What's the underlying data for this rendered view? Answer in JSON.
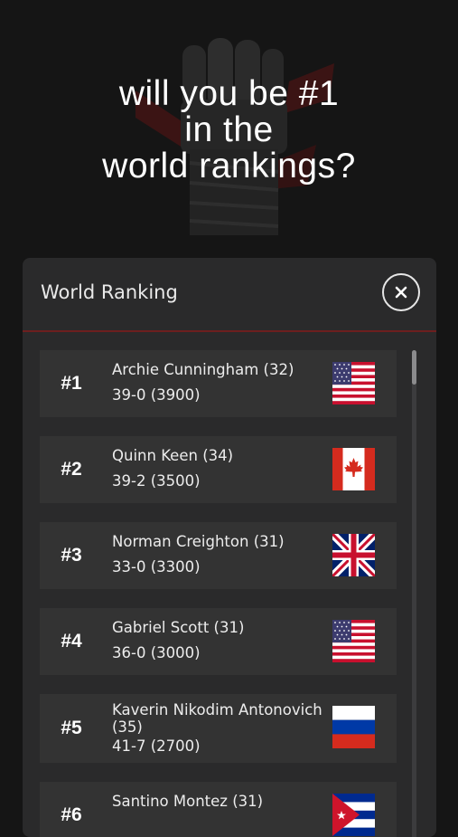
{
  "hero": {
    "line1": "will you be #1",
    "line2": "in the",
    "line3": "world rankings?",
    "art_icon": "raised-fist-icon"
  },
  "panel": {
    "title": "World Ranking",
    "close_icon": "close-icon",
    "accent_color": "#6d1f1f"
  },
  "rankings": [
    {
      "rank": "#1",
      "name": "Archie Cunningham (32)",
      "record": "39-0 (3900)",
      "flag": "usa-flag-icon"
    },
    {
      "rank": "#2",
      "name": "Quinn Keen (34)",
      "record": "39-2 (3500)",
      "flag": "canada-flag-icon"
    },
    {
      "rank": "#3",
      "name": "Norman Creighton (31)",
      "record": "33-0 (3300)",
      "flag": "uk-flag-icon"
    },
    {
      "rank": "#4",
      "name": "Gabriel Scott (31)",
      "record": "36-0 (3000)",
      "flag": "usa-flag-icon"
    },
    {
      "rank": "#5",
      "name": "Kaverin Nikodim Antonovich (35)",
      "record": "41-7 (2700)",
      "flag": "russia-flag-icon"
    },
    {
      "rank": "#6",
      "name": "Santino Montez (31)",
      "record": "",
      "flag": "cuba-flag-icon"
    }
  ]
}
